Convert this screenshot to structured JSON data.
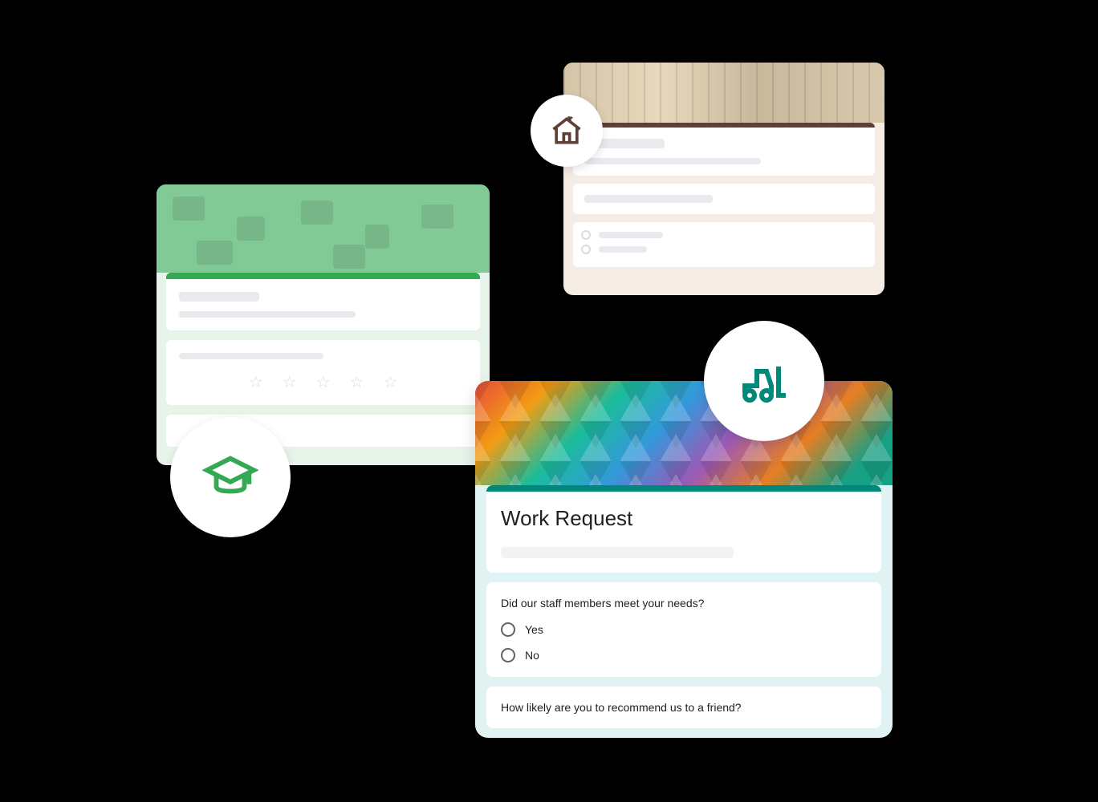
{
  "cards": {
    "education": {
      "accent": "#34a853",
      "icon": "graduation-cap-icon"
    },
    "housing": {
      "accent": "#5d4037",
      "icon": "house-icon"
    },
    "work": {
      "accent": "#00897b",
      "icon": "forklift-icon",
      "title": "Work Request",
      "question1": {
        "text": "Did our staff members meet your needs?",
        "options": [
          "Yes",
          "No"
        ]
      },
      "question2": {
        "text": "How likely are you to recommend us to a friend?"
      }
    }
  }
}
